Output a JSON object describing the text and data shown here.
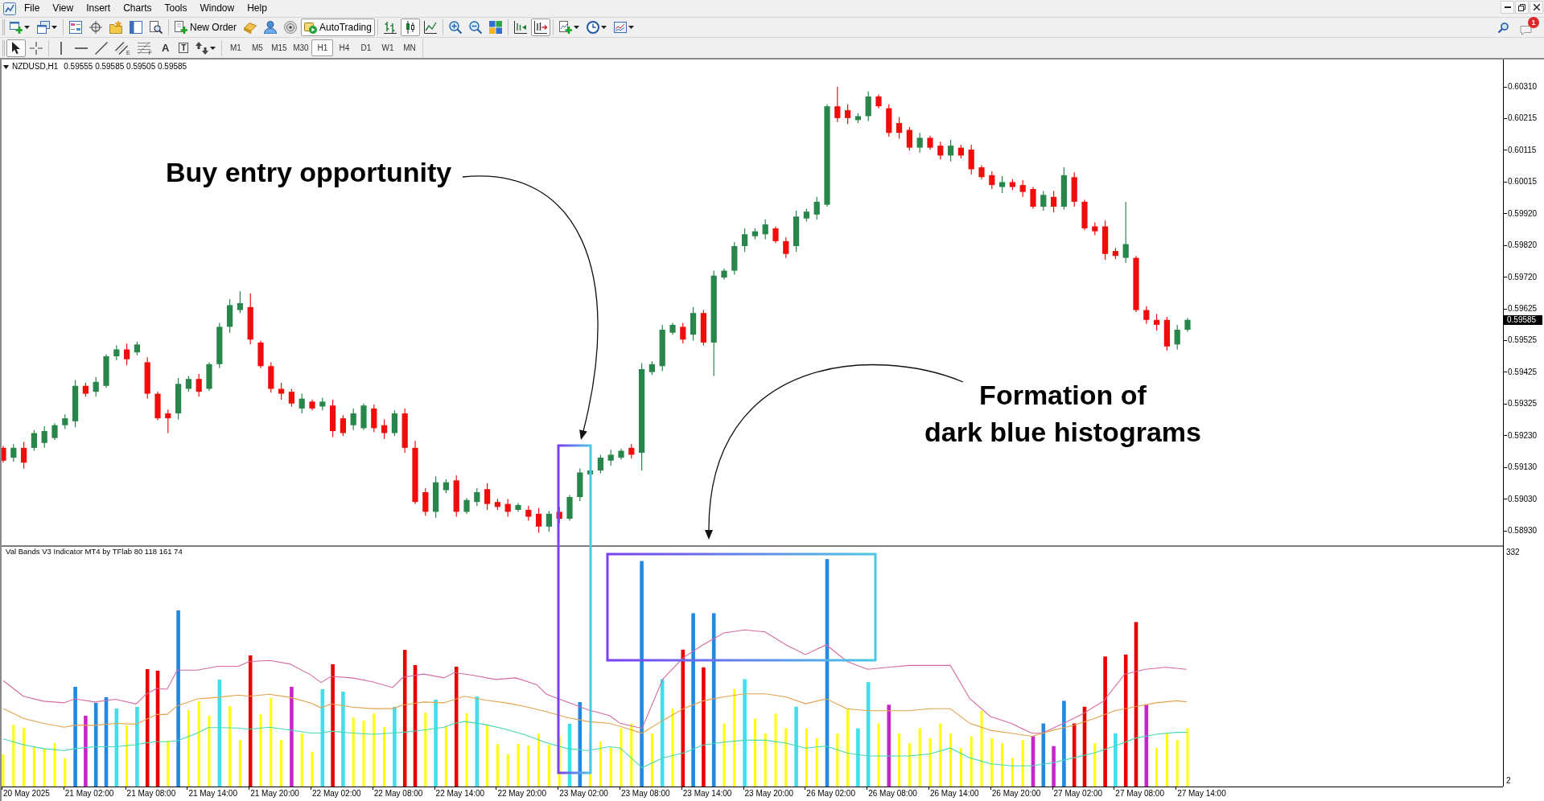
{
  "menu": {
    "items": [
      "File",
      "View",
      "Insert",
      "Charts",
      "Tools",
      "Window",
      "Help"
    ]
  },
  "window_controls": [
    {
      "kind": "minimize"
    },
    {
      "kind": "restore"
    },
    {
      "kind": "close"
    }
  ],
  "toolbar": {
    "groups": [
      [
        {
          "kind": "new-chart",
          "dropdown": true
        },
        {
          "kind": "profiles",
          "dropdown": true
        }
      ],
      [
        {
          "kind": "market-watch"
        },
        {
          "kind": "data-window"
        },
        {
          "kind": "navigator"
        },
        {
          "kind": "terminal"
        },
        {
          "kind": "tester"
        }
      ],
      [
        {
          "kind": "new-order",
          "label": "New Order"
        },
        {
          "kind": "editor"
        },
        {
          "kind": "community"
        },
        {
          "kind": "signals"
        },
        {
          "kind": "auto-trading",
          "label": "AutoTrading",
          "on": true
        }
      ],
      [
        {
          "kind": "bar-chart",
          "selected": false
        },
        {
          "kind": "candlesticks",
          "selected": true
        },
        {
          "kind": "line-chart",
          "selected": false
        }
      ],
      [
        {
          "kind": "zoom-in"
        },
        {
          "kind": "zoom-out"
        },
        {
          "kind": "tile"
        }
      ],
      [
        {
          "kind": "chart-shift",
          "on": false
        },
        {
          "kind": "auto-scroll",
          "on": true
        }
      ],
      [
        {
          "kind": "indicators",
          "dropdown": true
        },
        {
          "kind": "periods",
          "dropdown": true
        },
        {
          "kind": "templates",
          "dropdown": true
        }
      ]
    ],
    "messages_badge": "1"
  },
  "drawing_toolbar": {
    "groups": [
      [
        {
          "kind": "cursor",
          "selected": true
        },
        {
          "kind": "crosshair",
          "selected": false
        }
      ],
      [
        {
          "kind": "vertical-line"
        },
        {
          "kind": "horizontal-line"
        },
        {
          "kind": "trend-line"
        },
        {
          "kind": "channel",
          "glyph": "E"
        },
        {
          "kind": "fibonacci",
          "glyph": "F"
        },
        {
          "kind": "text",
          "glyph": "A"
        },
        {
          "kind": "label",
          "glyph": "T"
        },
        {
          "kind": "arrows",
          "dropdown": true
        }
      ]
    ],
    "timeframes": [
      {
        "label": "M1",
        "selected": false
      },
      {
        "label": "M5",
        "selected": false
      },
      {
        "label": "M15",
        "selected": false
      },
      {
        "label": "M30",
        "selected": false
      },
      {
        "label": "H1",
        "selected": true
      },
      {
        "label": "H4",
        "selected": false
      },
      {
        "label": "D1",
        "selected": false
      },
      {
        "label": "W1",
        "selected": false
      },
      {
        "label": "MN",
        "selected": false
      }
    ]
  },
  "chart": {
    "symbol": "NZDUSD,H1",
    "quote": "0.59555 0.59585 0.59505 0.59585",
    "price_labels": [
      "0.60310",
      "0.60215",
      "0.60115",
      "0.60015",
      "0.59920",
      "0.59820",
      "0.59720",
      "0.59625",
      "0.59525",
      "0.59425",
      "0.59325",
      "0.59230",
      "0.59130",
      "0.59030",
      "0.58930"
    ],
    "current_price": "0.59585"
  },
  "indicator": {
    "title": "Val Bands V3 Indicator MT4 by TFlab 80 118 161 74",
    "scale_labels": [
      "332",
      "2"
    ]
  },
  "time_axis": {
    "labels": [
      "20 May 2025",
      "21 May 02:00",
      "21 May 08:00",
      "21 May 14:00",
      "21 May 20:00",
      "22 May 02:00",
      "22 May 08:00",
      "22 May 14:00",
      "22 May 20:00",
      "23 May 02:00",
      "23 May 08:00",
      "23 May 14:00",
      "23 May 20:00",
      "26 May 02:00",
      "26 May 08:00",
      "26 May 14:00",
      "26 May 20:00",
      "27 May 02:00",
      "27 May 08:00",
      "27 May 14:00"
    ]
  },
  "annotations": [
    {
      "text": "Buy entry opportunity"
    },
    {
      "text": "Formation of\ndark blue histograms"
    }
  ]
}
